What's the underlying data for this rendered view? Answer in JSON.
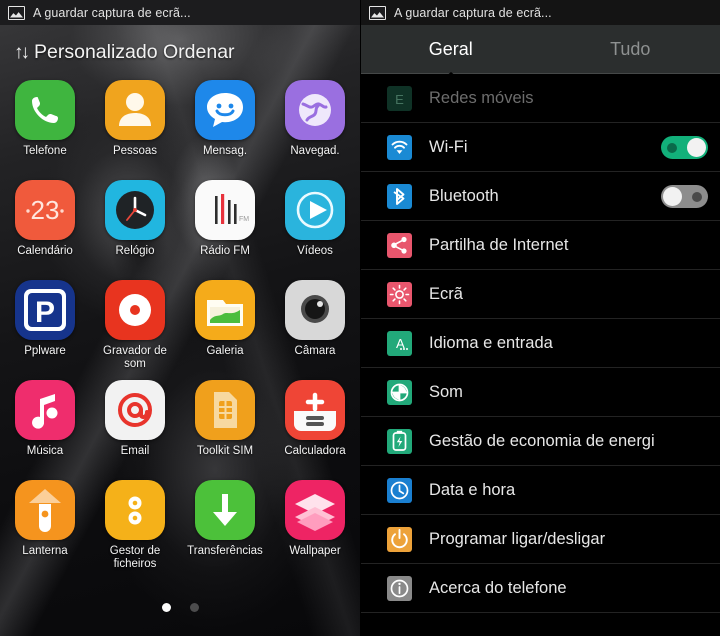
{
  "home": {
    "status_bar": {
      "icon": "image-icon",
      "text": "A guardar captura de ecrã..."
    },
    "header": {
      "sort_icon": "sort-updown-icon",
      "title": "Personalizado Ordenar"
    },
    "apps": [
      {
        "label": "Telefone",
        "icon": "phone-icon",
        "color": "#3fb53f"
      },
      {
        "label": "Pessoas",
        "icon": "contacts-icon",
        "color": "#f0a41e"
      },
      {
        "label": "Mensag.",
        "icon": "messaging-icon",
        "color": "#1e88ea"
      },
      {
        "label": "Navegad.",
        "icon": "browser-globe-icon",
        "color": "#9a6fe0"
      },
      {
        "label": "Calendário",
        "icon": "calendar-icon",
        "color": "#f05a3c",
        "badge": "23"
      },
      {
        "label": "Relógio",
        "icon": "clock-icon",
        "color": "#21b6e0"
      },
      {
        "label": "Rádio FM",
        "icon": "radio-fm-icon",
        "color": "#fafafa"
      },
      {
        "label": "Vídeos",
        "icon": "video-play-icon",
        "color": "#2ab4dd"
      },
      {
        "label": "Pplware",
        "icon": "pplware-p-icon",
        "color": "#16348c"
      },
      {
        "label": "Gravador de som",
        "icon": "sound-recorder-icon",
        "color": "#e8341f"
      },
      {
        "label": "Galeria",
        "icon": "gallery-icon",
        "color": "#f5ab1a"
      },
      {
        "label": "Câmara",
        "icon": "camera-icon",
        "color": "#d8d8d8"
      },
      {
        "label": "Música",
        "icon": "music-note-icon",
        "color": "#ef2d6d"
      },
      {
        "label": "Email",
        "icon": "email-at-icon",
        "color": "#f2f2f2"
      },
      {
        "label": "Toolkit SIM",
        "icon": "sim-card-icon",
        "color": "#f0a01c"
      },
      {
        "label": "Calculadora",
        "icon": "calculator-icon",
        "color": "#ef4536"
      },
      {
        "label": "Lanterna",
        "icon": "flashlight-icon",
        "color": "#f5941e"
      },
      {
        "label": "Gestor de ficheiros",
        "icon": "file-manager-icon",
        "color": "#f5b119"
      },
      {
        "label": "Transferências",
        "icon": "downloads-arrow-icon",
        "color": "#4cc13a"
      },
      {
        "label": "Wallpaper",
        "icon": "wallpaper-layers-icon",
        "color": "#ee2464"
      }
    ],
    "page_indicator": {
      "total": 2,
      "active": 1
    }
  },
  "settings": {
    "status_bar": {
      "icon": "image-icon",
      "text": "A guardar captura de ecrã..."
    },
    "tabs": [
      {
        "label": "Geral",
        "active": true
      },
      {
        "label": "Tudo",
        "active": false
      }
    ],
    "items": [
      {
        "label": "Redes móveis",
        "icon": "mobile-network-e-icon",
        "color": "#1d5c45",
        "disabled": true,
        "toggle": null
      },
      {
        "label": "Wi-Fi",
        "icon": "wifi-icon",
        "color": "#1a8ad4",
        "disabled": false,
        "toggle": "on"
      },
      {
        "label": "Bluetooth",
        "icon": "bluetooth-icon",
        "color": "#1a8ad4",
        "disabled": false,
        "toggle": "off"
      },
      {
        "label": "Partilha de Internet",
        "icon": "tethering-share-icon",
        "color": "#e8566d",
        "disabled": false,
        "toggle": null
      },
      {
        "label": "Ecrã",
        "icon": "display-brightness-icon",
        "color": "#e8566d",
        "disabled": false,
        "toggle": null
      },
      {
        "label": "Idioma e entrada",
        "icon": "language-input-icon",
        "color": "#22a97a",
        "disabled": false,
        "toggle": null
      },
      {
        "label": "Som",
        "icon": "sound-icon",
        "color": "#22a97a",
        "disabled": false,
        "toggle": null
      },
      {
        "label": "Gestão de economia de energi",
        "icon": "battery-saver-icon",
        "color": "#22a97a",
        "disabled": false,
        "toggle": null
      },
      {
        "label": "Data e hora",
        "icon": "date-time-clock-icon",
        "color": "#1a7fd0",
        "disabled": false,
        "toggle": null
      },
      {
        "label": "Programar ligar/desligar",
        "icon": "power-schedule-icon",
        "color": "#eda23a",
        "disabled": false,
        "toggle": null
      },
      {
        "label": "Acerca do telefone",
        "icon": "about-info-icon",
        "color": "#8a8a8a",
        "disabled": false,
        "toggle": null
      }
    ]
  }
}
